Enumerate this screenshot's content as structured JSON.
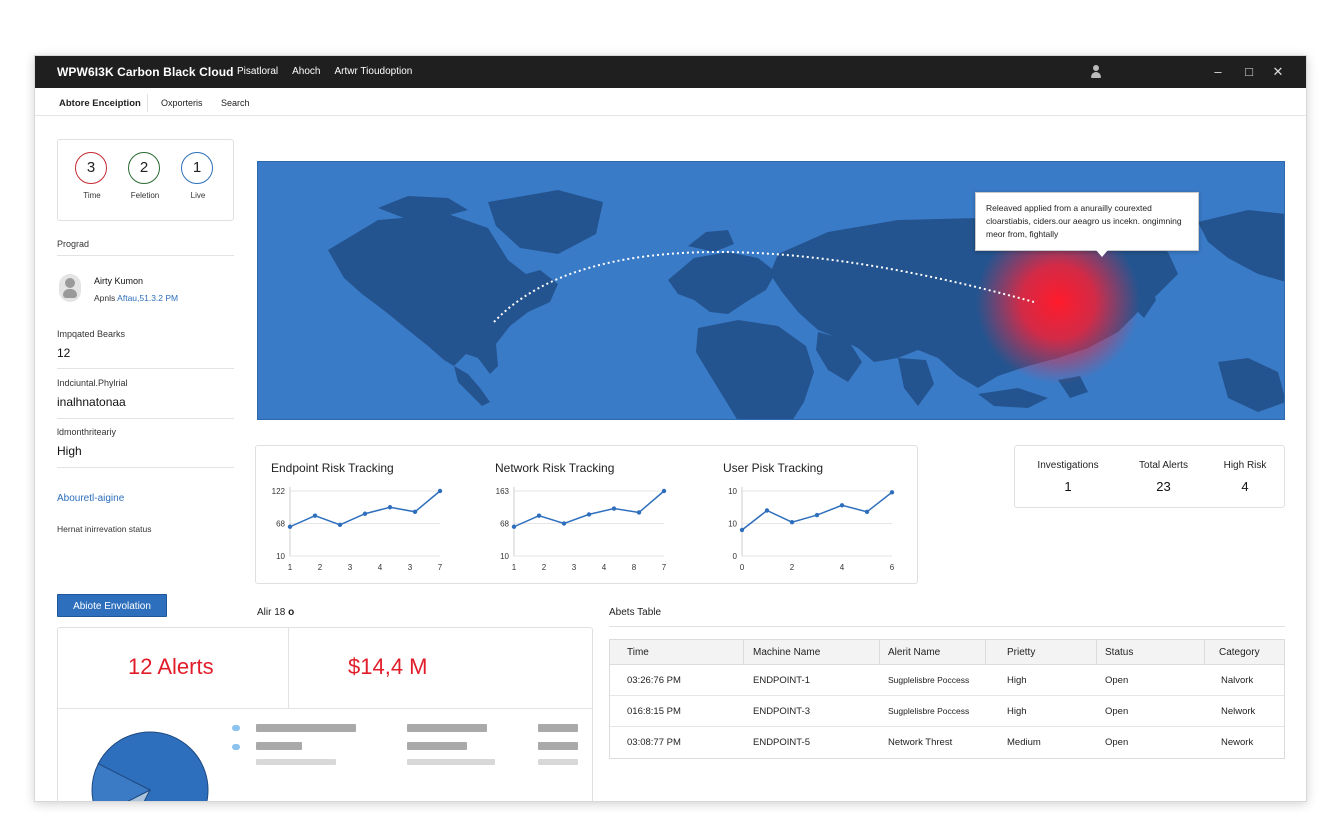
{
  "app": {
    "title": "WPW6I3K Carbon Black Cloud",
    "nav": [
      "Pisatloral",
      "Ahoch",
      "Artwr Tioudoption"
    ]
  },
  "subnav": {
    "tabs": [
      "Abtore Enceiption",
      "Oxporteris",
      "Search"
    ]
  },
  "counters": [
    {
      "value": "3",
      "label": "Time",
      "color": "#c62a33"
    },
    {
      "value": "2",
      "label": "Feletion",
      "color": "#2a6a33"
    },
    {
      "value": "1",
      "label": "Live",
      "color": "#2e6fbd"
    }
  ],
  "sidebar": {
    "section_label": "Prograd",
    "user_name": "Airty Kumon",
    "user_meta_prefix": "Apnls",
    "user_meta_link": "Aftau,51.3.2 PM",
    "impacted_label": "Impqated Bearks",
    "impacted_value": "12",
    "industrial_label": "Indciuntal.Phylrial",
    "industrial_value": "inalhnatonaa",
    "monthly_label": "ldmonthriteariy",
    "monthly_value": "High",
    "link_text": "Abouretl-aigine",
    "status_text": "Hernat inirrevation status"
  },
  "map": {
    "callout": "Releaved applied from a anurailly courexted cloarstiabis, ciders.our aeagro us incekn. ongimning meor from, fightally"
  },
  "charts": [
    {
      "title": "Endpoint Risk Tracking",
      "y_ticks": [
        "122",
        "68",
        "10"
      ],
      "x_ticks": [
        "1",
        "2",
        "3",
        "4",
        "3",
        "7"
      ],
      "points": [
        0.45,
        0.62,
        0.48,
        0.65,
        0.75,
        0.68,
        1.0
      ]
    },
    {
      "title": "Network Risk Tracking",
      "y_ticks": [
        "163",
        "68",
        "10"
      ],
      "x_ticks": [
        "1",
        "2",
        "3",
        "4",
        "8",
        "7"
      ],
      "points": [
        0.45,
        0.62,
        0.5,
        0.64,
        0.73,
        0.67,
        1.0
      ]
    },
    {
      "title": "User Pisk Tracking",
      "y_ticks": [
        "10",
        "10",
        "0"
      ],
      "x_ticks": [
        "0",
        "2",
        "4",
        "6"
      ],
      "points": [
        0.4,
        0.7,
        0.52,
        0.63,
        0.78,
        0.68,
        0.98
      ]
    }
  ],
  "stats": [
    {
      "label": "Investigations",
      "value": "1"
    },
    {
      "label": "Total Alerts",
      "value": "23"
    },
    {
      "label": "High Risk",
      "value": "4"
    }
  ],
  "evaluation_button": "Abiote Envolation",
  "alir_label": "Alir 18",
  "alir_suffix": "o",
  "summary": {
    "alerts": "12 Alerts",
    "amount": "$14,4 M"
  },
  "pie": {
    "slices": [
      0.75,
      0.1,
      0.15
    ],
    "colors": [
      "#2e6fbd",
      "#a9c3dc",
      "#3b7bc6"
    ]
  },
  "table": {
    "title": "Abets Table",
    "columns": [
      "Time",
      "Machine Name",
      "Alerit Name",
      "Prietty",
      "Status",
      "Category"
    ],
    "rows": [
      [
        "03:26:76 PM",
        "ENDPOINT-1",
        "Sugplelisbre Poccess",
        "High",
        "Open",
        "Nalvork"
      ],
      [
        "016:8:15 PM",
        "ENDPOINT-3",
        "Sugplelisbre Poccess",
        "High",
        "Open",
        "Nelwork"
      ],
      [
        "03:08:77 PM",
        "ENDPOINT-5",
        "Network Threst",
        "Medium",
        "Open",
        "Nework"
      ]
    ]
  }
}
